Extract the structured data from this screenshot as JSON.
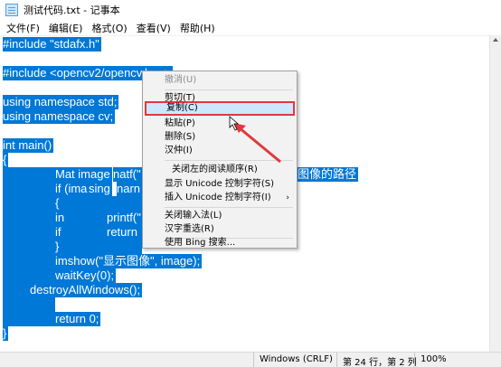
{
  "window": {
    "title": "测试代码.txt - 记事本"
  },
  "menubar": {
    "items": [
      "文件(F)",
      "编辑(E)",
      "格式(O)",
      "查看(V)",
      "帮助(H)"
    ]
  },
  "editor": {
    "lines": [
      "#include \"stdafx.h\"",
      "#include <opencv2/opencv.hpp>",
      "using namespace std;",
      "using namespace cv;",
      "int main()",
      "{",
      "Mat image",
      "natf(\"",
      "图像的路径",
      "if (ima",
      "sing",
      "narn",
      "{",
      "in",
      "printf(\"",
      "if",
      "return",
      "}",
      "imshow(\"显示图像\", image);",
      "waitKey(0);",
      "destroyAllWindows();",
      "return 0;",
      "}"
    ]
  },
  "context_menu": {
    "items": [
      {
        "label": "撤消(U)",
        "disabled": true
      },
      {
        "label": "剪切(T)"
      },
      {
        "label": "复制(C)",
        "highlighted": true
      },
      {
        "label": "粘贴(P)"
      },
      {
        "label": "删除(S)"
      },
      {
        "label": "汉仲(I)"
      },
      {
        "label": "关闭左的阅读顺序(R)"
      },
      {
        "label": "显示 Unicode 控制字符(S)"
      },
      {
        "label": "插入 Unicode 控制字符(I)",
        "submenu": "›"
      },
      {
        "label": "关闭输入法(L)"
      },
      {
        "label": "汉字重选(R)"
      },
      {
        "label": "使用 Bing 搜索..."
      }
    ]
  },
  "statusbar": {
    "encoding": "Windows (CRLF)",
    "position": "第 24 行，第 2 列",
    "zoom": "100%"
  },
  "colors": {
    "selection": "#0078d7",
    "highlight_border": "#e0393e",
    "arrow": "#e0393e"
  }
}
